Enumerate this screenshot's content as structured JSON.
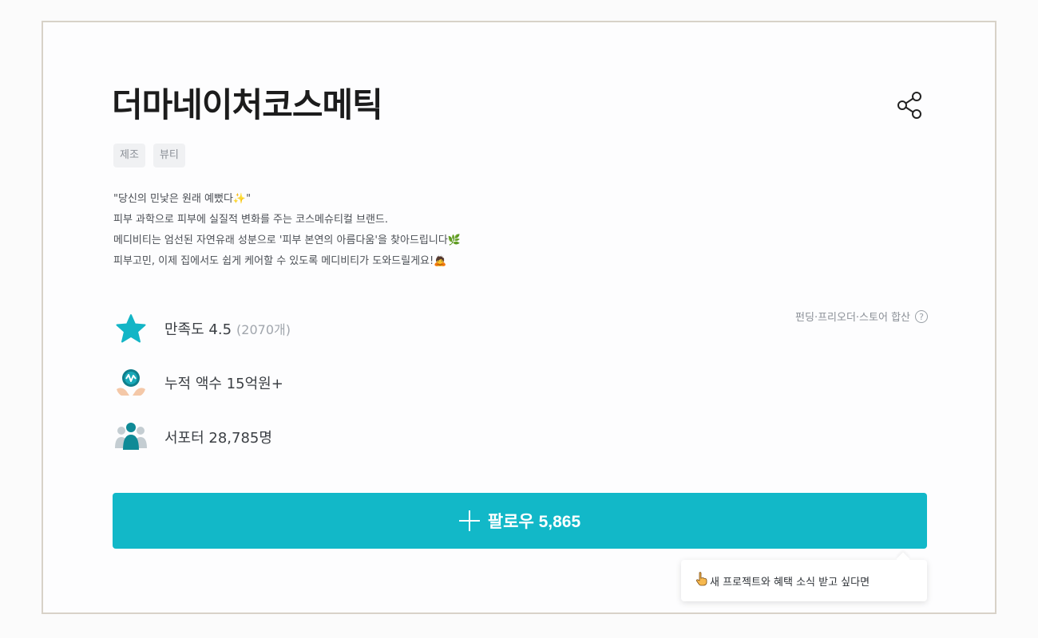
{
  "brand": {
    "title": "더마네이처코스메틱",
    "tags": [
      "제조",
      "뷰티"
    ]
  },
  "description": {
    "lines": [
      "\"당신의 민낯은 원래 예뻤다✨\"",
      "피부 과학으로 피부에 실질적 변화를 주는 코스메슈티컬 브랜드.",
      "메디비티는 엄선된 자연유래 성분으로 '피부 본연의 아름다움'을 찾아드립니다🌿",
      "피부고민, 이제 집에서도 쉽게 케어할 수 있도록 메디비티가 도와드릴게요!🙇"
    ]
  },
  "stats": {
    "satisfaction_label": "만족도 4.5",
    "satisfaction_count": "(2070개)",
    "revenue_label": "누적 액수 15억원+",
    "supporters_label": "서포터 28,785명",
    "note": "펀딩·프리오더·스토어 합산"
  },
  "follow": {
    "label": "팔로우 5,865"
  },
  "tooltip": {
    "text": "새 프로젝트와 혜택 소식 받고 싶다면"
  },
  "colors": {
    "accent": "#12b8c8",
    "star": "#13b5c6"
  },
  "icons": {
    "share": "share-icon",
    "star": "star-icon",
    "revenue": "coin-hands-icon",
    "supporters": "people-icon",
    "help": "help-circle-icon",
    "plus": "plus-icon",
    "pointer": "pointing-hand-icon"
  }
}
